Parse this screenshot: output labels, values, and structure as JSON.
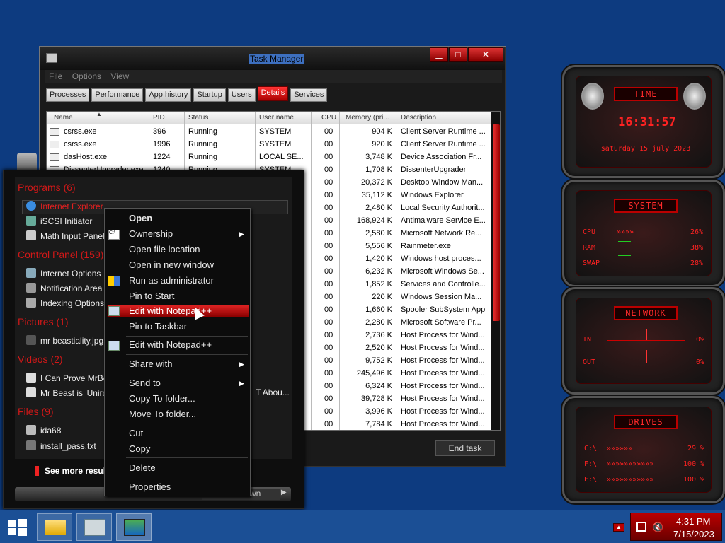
{
  "task_manager": {
    "title": "Task Manager",
    "menu": [
      "File",
      "Options",
      "View"
    ],
    "tabs": [
      "Processes",
      "Performance",
      "App history",
      "Startup",
      "Users",
      "Details",
      "Services"
    ],
    "selected_tab": "Details",
    "columns": [
      "Name",
      "PID",
      "Status",
      "User name",
      "CPU",
      "Memory (pri...",
      "Description"
    ],
    "rows": [
      {
        "name": "csrss.exe",
        "pid": "396",
        "status": "Running",
        "user": "SYSTEM",
        "cpu": "00",
        "mem": "904 K",
        "desc": "Client Server Runtime ..."
      },
      {
        "name": "csrss.exe",
        "pid": "1996",
        "status": "Running",
        "user": "SYSTEM",
        "cpu": "00",
        "mem": "920 K",
        "desc": "Client Server Runtime ..."
      },
      {
        "name": "dasHost.exe",
        "pid": "1224",
        "status": "Running",
        "user": "LOCAL SE...",
        "cpu": "00",
        "mem": "3,748 K",
        "desc": "Device Association Fr..."
      },
      {
        "name": "DissenterUpgrader.exe",
        "pid": "1240",
        "status": "Running",
        "user": "SYSTEM",
        "cpu": "00",
        "mem": "1,708 K",
        "desc": "DissenterUpgrader"
      },
      {
        "name": "",
        "pid": "",
        "status": "",
        "user": "",
        "cpu": "00",
        "mem": "20,372 K",
        "desc": "Desktop Window Man..."
      },
      {
        "name": "",
        "pid": "",
        "status": "",
        "user": "",
        "cpu": "00",
        "mem": "35,112 K",
        "desc": "Windows Explorer"
      },
      {
        "name": "",
        "pid": "",
        "status": "",
        "user": "",
        "cpu": "00",
        "mem": "2,480 K",
        "desc": "Local Security Authorit..."
      },
      {
        "name": "",
        "pid": "",
        "status": "",
        "user": "",
        "cpu": "00",
        "mem": "168,924 K",
        "desc": "Antimalware Service E..."
      },
      {
        "name": "",
        "pid": "",
        "status": "",
        "user": "",
        "cpu": "00",
        "mem": "2,580 K",
        "desc": "Microsoft Network Re..."
      },
      {
        "name": "",
        "pid": "",
        "status": "",
        "user": "",
        "cpu": "00",
        "mem": "5,556 K",
        "desc": "Rainmeter.exe"
      },
      {
        "name": "",
        "pid": "",
        "status": "",
        "user": "",
        "cpu": "00",
        "mem": "1,420 K",
        "desc": "Windows host proces..."
      },
      {
        "name": "",
        "pid": "",
        "status": "",
        "user": "",
        "cpu": "00",
        "mem": "6,232 K",
        "desc": "Microsoft Windows Se..."
      },
      {
        "name": "",
        "pid": "",
        "status": "",
        "user": "",
        "cpu": "00",
        "mem": "1,852 K",
        "desc": "Services and Controlle..."
      },
      {
        "name": "",
        "pid": "",
        "status": "",
        "user": "",
        "cpu": "00",
        "mem": "220 K",
        "desc": "Windows Session Ma..."
      },
      {
        "name": "",
        "pid": "",
        "status": "",
        "user": "",
        "cpu": "00",
        "mem": "1,660 K",
        "desc": "Spooler SubSystem App"
      },
      {
        "name": "",
        "pid": "",
        "status": "",
        "user": "",
        "cpu": "00",
        "mem": "2,280 K",
        "desc": "Microsoft Software Pr..."
      },
      {
        "name": "",
        "pid": "",
        "status": "",
        "user": "",
        "cpu": "00",
        "mem": "2,736 K",
        "desc": "Host Process for Wind..."
      },
      {
        "name": "",
        "pid": "",
        "status": "",
        "user": "",
        "cpu": "00",
        "mem": "2,520 K",
        "desc": "Host Process for Wind..."
      },
      {
        "name": "",
        "pid": "",
        "status": "",
        "user": "",
        "cpu": "00",
        "mem": "9,752 K",
        "desc": "Host Process for Wind..."
      },
      {
        "name": "",
        "pid": "",
        "status": "",
        "user": "",
        "cpu": "00",
        "mem": "245,496 K",
        "desc": "Host Process for Wind..."
      },
      {
        "name": "",
        "pid": "",
        "status": "",
        "user": "",
        "cpu": "00",
        "mem": "6,324 K",
        "desc": "Host Process for Wind..."
      },
      {
        "name": "",
        "pid": "",
        "status": "",
        "user": "",
        "cpu": "00",
        "mem": "39,728 K",
        "desc": "Host Process for Wind..."
      },
      {
        "name": "",
        "pid": "",
        "status": "",
        "user": "",
        "cpu": "00",
        "mem": "3,996 K",
        "desc": "Host Process for Wind..."
      },
      {
        "name": "",
        "pid": "",
        "status": "",
        "user": "",
        "cpu": "00",
        "mem": "7,784 K",
        "desc": "Host Process for Wind..."
      }
    ],
    "end_task_label": "End task"
  },
  "start_menu": {
    "categories": [
      {
        "label": "Programs (6)",
        "items": [
          "Internet Explorer",
          "iSCSI Initiator",
          "Math Input Panel"
        ]
      },
      {
        "label": "Control Panel (159)",
        "items": [
          "Internet Options",
          "Notification Area I",
          "Indexing Options"
        ]
      },
      {
        "label": "Pictures (1)",
        "items": [
          "mr beastiality.jpg"
        ]
      },
      {
        "label": "Videos (2)",
        "items": [
          "I Can Prove MrBea",
          "Mr Beast is 'Uniro"
        ]
      },
      {
        "label": "Files (9)",
        "items": [
          "ida68",
          "install_pass.txt"
        ]
      }
    ],
    "partial_text": "T Abou...",
    "see_more": "See more results",
    "shutdown_label": "Shut down"
  },
  "context_menu": {
    "items": [
      "Open",
      "Ownership",
      "Open file location",
      "Open in new window",
      "Run as administrator",
      "Pin to Start",
      "Edit with Notepad++",
      "Pin to Taskbar",
      "Edit with Notepad++",
      "Share with",
      "Send to",
      "Copy To folder...",
      "Move To folder...",
      "Cut",
      "Copy",
      "Delete",
      "Properties"
    ],
    "highlighted": "Edit with Notepad++"
  },
  "gadgets": {
    "time": {
      "title": "TIME",
      "clock": "16:31:57",
      "date": "saturday 15 july 2023"
    },
    "system": {
      "title": "SYSTEM",
      "cpu_label": "CPU",
      "cpu": "26%",
      "ram_label": "RAM",
      "ram": "38%",
      "swap_label": "SWAP",
      "swap": "28%"
    },
    "network": {
      "title": "NETWORK",
      "in_label": "IN",
      "in": "0%",
      "out_label": "OUT",
      "out": "0%"
    },
    "drives": {
      "title": "DRIVES",
      "c_label": "C:\\",
      "c": "29 %",
      "f_label": "F:\\",
      "f": "100 %",
      "e_label": "E:\\",
      "e": "100 %"
    }
  },
  "taskbar": {
    "time": "4:31 PM",
    "date": "7/15/2023",
    "accent": "#b00000"
  }
}
